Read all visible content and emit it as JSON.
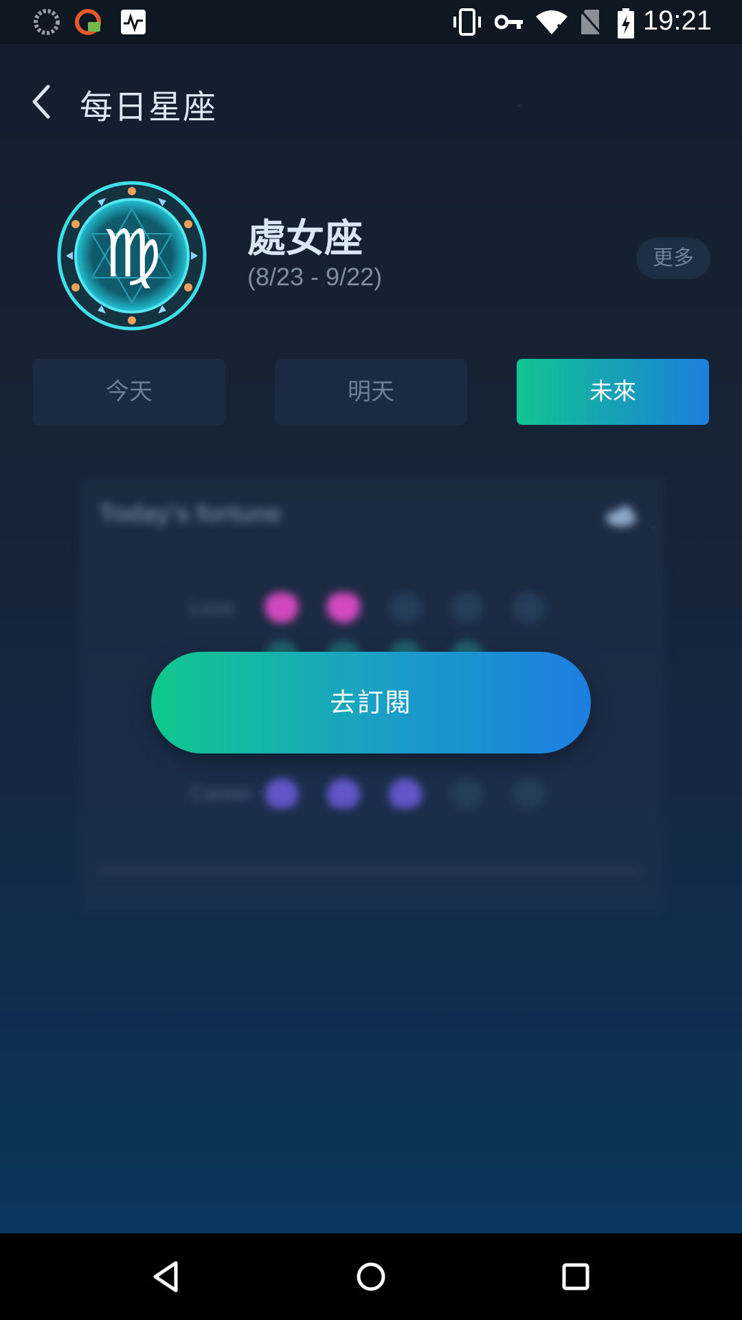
{
  "status_bar": {
    "time": "19:21",
    "left_icons": [
      "loading-icon",
      "app-notification-icon",
      "activity-monitor-icon"
    ],
    "right_icons": [
      "vibrate-icon",
      "vpn-key-icon",
      "wifi-off-icon",
      "no-sim-icon",
      "battery-charging-icon"
    ]
  },
  "header": {
    "title": "每日星座",
    "back_icon": "chevron-left-icon"
  },
  "sign": {
    "name": "處女座",
    "dates": "(8/23 - 9/22)",
    "emblem_icon": "virgo-emblem-icon",
    "more_label": "更多"
  },
  "tabs": [
    {
      "label": "今天",
      "active": false
    },
    {
      "label": "明天",
      "active": false
    },
    {
      "label": "未來",
      "active": true
    }
  ],
  "preview_card": {
    "title": "Today's fortune",
    "rows": [
      {
        "label": "Love"
      },
      {
        "label": "Career"
      }
    ]
  },
  "subscribe": {
    "label": "去訂閱"
  },
  "colors": {
    "accent_start": "#12c491",
    "accent_end": "#1c7fdd",
    "background_top": "#141d2b",
    "background_bottom": "#063a63"
  },
  "nav_bar": {
    "icons": [
      "back-triangle-icon",
      "home-circle-icon",
      "recents-square-icon"
    ]
  }
}
